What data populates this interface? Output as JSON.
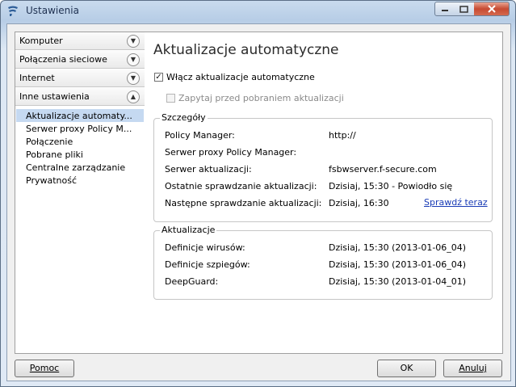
{
  "window": {
    "title": "Ustawienia",
    "controls": {
      "minimize_icon": "minimize-icon",
      "maximize_icon": "maximize-icon",
      "close_icon": "close-icon"
    }
  },
  "sidebar": {
    "categories": [
      {
        "label": "Komputer",
        "icon": "chevron-down-icon"
      },
      {
        "label": "Połączenia sieciowe",
        "icon": "chevron-down-icon"
      },
      {
        "label": "Internet",
        "icon": "chevron-down-icon"
      },
      {
        "label": "Inne ustawienia",
        "icon": "chevron-up-icon"
      }
    ],
    "subitems": [
      {
        "label": "Aktualizacje automaty...",
        "selected": true
      },
      {
        "label": "Serwer proxy Policy M..."
      },
      {
        "label": "Połączenie"
      },
      {
        "label": "Pobrane pliki"
      },
      {
        "label": "Centralne zarządzanie"
      },
      {
        "label": "Prywatność"
      }
    ]
  },
  "main": {
    "title": "Aktualizacje automatyczne",
    "enable_auto_updates": {
      "label": "Włącz aktualizacje automatyczne",
      "checked": true
    },
    "ask_before_download": {
      "label": "Zapytaj przed pobraniem aktualizacji",
      "checked": false,
      "disabled": true
    },
    "details": {
      "title": "Szczegóły",
      "rows": [
        {
          "key": "Policy Manager:",
          "value": "http://"
        },
        {
          "key": "Serwer proxy Policy Manager:",
          "value": ""
        },
        {
          "key": "Serwer aktualizacji:",
          "value": "fsbwserver.f-secure.com"
        },
        {
          "key": "Ostatnie sprawdzanie aktualizacji:",
          "value": "Dzisiaj, 15:30 - Powiodło się"
        },
        {
          "key": "Następne sprawdzanie aktualizacji:",
          "value": "Dzisiaj, 16:30"
        }
      ],
      "check_now_link": "Sprawdź teraz"
    },
    "updates": {
      "title": "Aktualizacje",
      "rows": [
        {
          "key": "Definicje wirusów:",
          "value": "Dzisiaj, 15:30 (2013-01-06_04)"
        },
        {
          "key": "Definicje szpiegów:",
          "value": "Dzisiaj, 15:30 (2013-01-06_04)"
        },
        {
          "key": "DeepGuard:",
          "value": "Dzisiaj, 15:30 (2013-01-04_01)"
        }
      ]
    }
  },
  "footer": {
    "help_label": "Pomoc",
    "ok_label": "OK",
    "cancel_label": "Anuluj"
  },
  "colors": {
    "selection": "#c5d9f1",
    "link": "#1a3cb6",
    "close_button": "#c74a32"
  }
}
